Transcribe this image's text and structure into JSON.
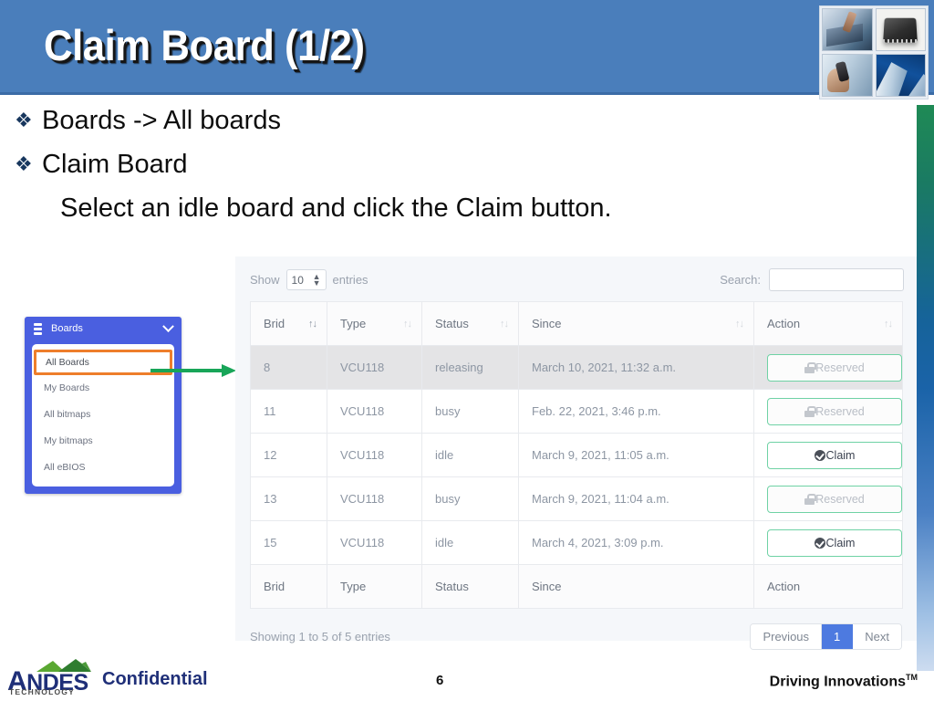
{
  "slide": {
    "title": "Claim Board (1/2)",
    "page_number": "6",
    "header_color": "#4a7ebb"
  },
  "bullets": [
    {
      "marker": "❖",
      "text": "Boards -> All boards"
    },
    {
      "marker": "❖",
      "text": "Claim Board"
    }
  ],
  "sub_text": "Select an idle board and click the Claim button.",
  "sidebar": {
    "title": "Boards",
    "icon": "server-icon",
    "chevron": "chevron-down-icon",
    "accent_color": "#4a5fe0",
    "highlight_color": "#ee7e2b",
    "items": [
      {
        "label": "All Boards",
        "active": true
      },
      {
        "label": "My Boards",
        "active": false
      },
      {
        "label": "All bitmaps",
        "active": false
      },
      {
        "label": "My bitmaps",
        "active": false
      },
      {
        "label": "All eBIOS",
        "active": false
      }
    ]
  },
  "arrow": {
    "name": "green-pointer-arrow",
    "color": "#18a558"
  },
  "datatable": {
    "length_label_before": "Show",
    "length_value": "10",
    "length_label_after": "entries",
    "search_label": "Search:",
    "search_value": "",
    "search_placeholder": "",
    "columns": [
      {
        "label": "Brid",
        "sort": "↑↓",
        "active_sort": true
      },
      {
        "label": "Type",
        "sort": "↑↓",
        "active_sort": false
      },
      {
        "label": "Status",
        "sort": "↑↓",
        "active_sort": false
      },
      {
        "label": "Since",
        "sort": "↑↓",
        "active_sort": false
      },
      {
        "label": "Action",
        "sort": "↑↓",
        "active_sort": false
      }
    ],
    "rows": [
      {
        "brid": "8",
        "type": "VCU118",
        "status": "releasing",
        "since": "March 10, 2021, 11:32 a.m.",
        "action_label": "Reserved",
        "action_state": "reserved",
        "action_icon": "lock-icon",
        "hover": true
      },
      {
        "brid": "11",
        "type": "VCU118",
        "status": "busy",
        "since": "Feb. 22, 2021, 3:46 p.m.",
        "action_label": "Reserved",
        "action_state": "reserved",
        "action_icon": "lock-icon",
        "hover": false
      },
      {
        "brid": "12",
        "type": "VCU118",
        "status": "idle",
        "since": "March 9, 2021, 11:05 a.m.",
        "action_label": "Claim",
        "action_state": "claim",
        "action_icon": "check-circle-icon",
        "hover": false
      },
      {
        "brid": "13",
        "type": "VCU118",
        "status": "busy",
        "since": "March 9, 2021, 11:04 a.m.",
        "action_label": "Reserved",
        "action_state": "reserved",
        "action_icon": "lock-icon",
        "hover": false
      },
      {
        "brid": "15",
        "type": "VCU118",
        "status": "idle",
        "since": "March 4, 2021, 3:09 p.m.",
        "action_label": "Claim",
        "action_state": "claim",
        "action_icon": "check-circle-icon",
        "hover": false
      }
    ],
    "footer_columns": [
      "Brid",
      "Type",
      "Status",
      "Since",
      "Action"
    ],
    "info": "Showing 1 to 5 of 5 entries",
    "pagination": [
      {
        "label": "Previous",
        "active": false
      },
      {
        "label": "1",
        "active": true
      },
      {
        "label": "Next",
        "active": false
      }
    ]
  },
  "footer": {
    "logo_main": "NDES",
    "logo_initial": "A",
    "logo_sub": "TECHNOLOGY",
    "confidential": "Confidential",
    "tagline": "Driving Innovations",
    "tagline_tm": "TM"
  }
}
